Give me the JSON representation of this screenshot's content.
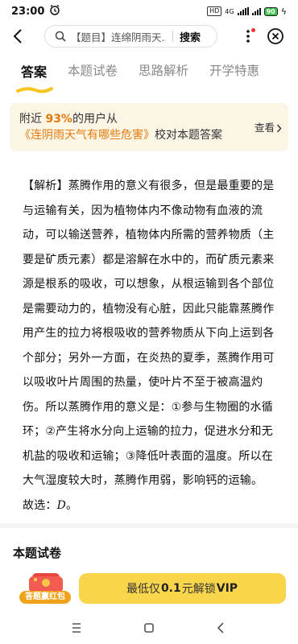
{
  "status": {
    "time": "23:00",
    "hd": "HD",
    "net": "4G",
    "battery": "90"
  },
  "search": {
    "placeholder": "【题目】连绵阴雨天...",
    "button": "搜索"
  },
  "tabs": [
    {
      "label": "答案",
      "active": true
    },
    {
      "label": "本题试卷",
      "active": false
    },
    {
      "label": "思路解析",
      "active": false
    },
    {
      "label": "开学特惠",
      "active": false
    }
  ],
  "notice": {
    "prefix": "附近 ",
    "percent": "93%",
    "middle": "的用户从 ",
    "link": "《连阴雨天气有哪些危害》",
    "suffix": "校对本题答案",
    "view": "查看"
  },
  "analysis": {
    "text": "【解析】蒸腾作用的意义有很多，但是最重要的是与运输有关，因为植物体内不像动物有血液的流动，可以输送营养，植物体内所需的营养物质（主要是矿质元素）都是溶解在水中的，而矿质元素来源是根系的吸收，可以想象，从根运输到各个部位是需要动力的，植物没有心脏，因此只能靠蒸腾作用产生的拉力将根吸收的营养物质从下向上运到各个部分；另外一方面，在炎热的夏季，蒸腾作用可以吸收叶片周围的热量，使叶片不至于被高温灼伤。所以蒸腾作用的意义是：①参与生物圈的水循环；②产生将水分向上运输的拉力，促进水分和无机盐的吸收和运输；③降低叶表面的温度。所以在大气湿度较大时，蒸腾作用弱，影响钙的运输。",
    "answer_prefix": "故选：",
    "answer": "D",
    "answer_suffix": "。"
  },
  "section": {
    "title": "本题试卷"
  },
  "bottom": {
    "redpack_label": "答题赢红包",
    "unlock_prefix": "最低仅",
    "unlock_price": "0.1",
    "unlock_mid": "元解锁",
    "unlock_vip": "VIP"
  },
  "colors": {
    "accent": "#e47a0a",
    "notice_bg": "#fbf5e6",
    "unlock_bg": "#f9d54c",
    "tab_underline": "#f7c51e"
  }
}
